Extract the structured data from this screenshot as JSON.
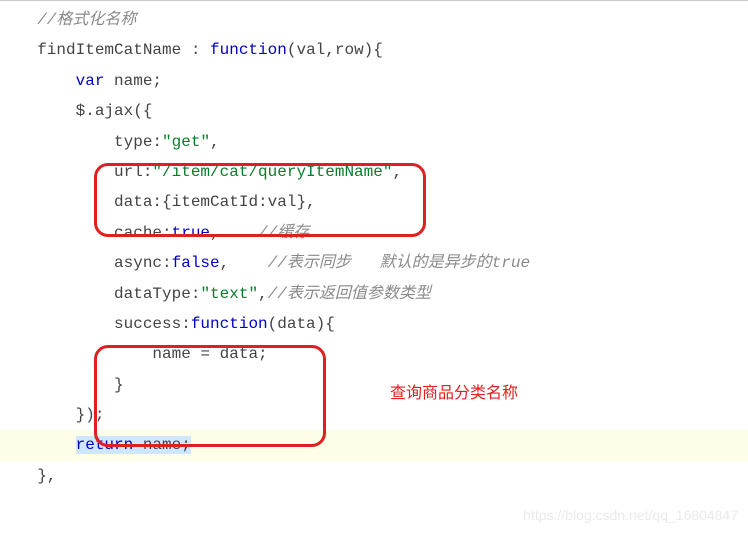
{
  "code": {
    "c1": "//格式化名称",
    "l2": {
      "a": "findItemCatName",
      "b": " : ",
      "c": "function",
      "d": "(val,row){"
    },
    "l3": {
      "a": "var",
      "b": " name;"
    },
    "l4": "$.ajax({",
    "l5": {
      "a": "type:",
      "b": "\"get\"",
      "c": ","
    },
    "l6": {
      "a": "url:",
      "b": "\"/item/cat/queryItemName\"",
      "c": ","
    },
    "l7": "data:{itemCatId:val},",
    "l8": {
      "a": "cache:",
      "b": "true",
      "c": ",",
      "cm": "//缓存"
    },
    "l9": {
      "a": "async:",
      "b": "false",
      "c": ",",
      "cm": "//表示同步   默认的是异步的true"
    },
    "l10": {
      "a": "dataType:",
      "b": "\"text\"",
      "c": ",",
      "cm": "//表示返回值参数类型"
    },
    "l11": {
      "a": "success:",
      "b": "function",
      "c": "(data){"
    },
    "l12": "name = data;",
    "l13": "}",
    "l14": "});",
    "l15": {
      "a": "return",
      "b": " name;"
    },
    "l16": "},"
  },
  "annot": {
    "label1": "查询商品分类名称"
  },
  "watermark": "https://blog.csdn.net/qq_16804847"
}
